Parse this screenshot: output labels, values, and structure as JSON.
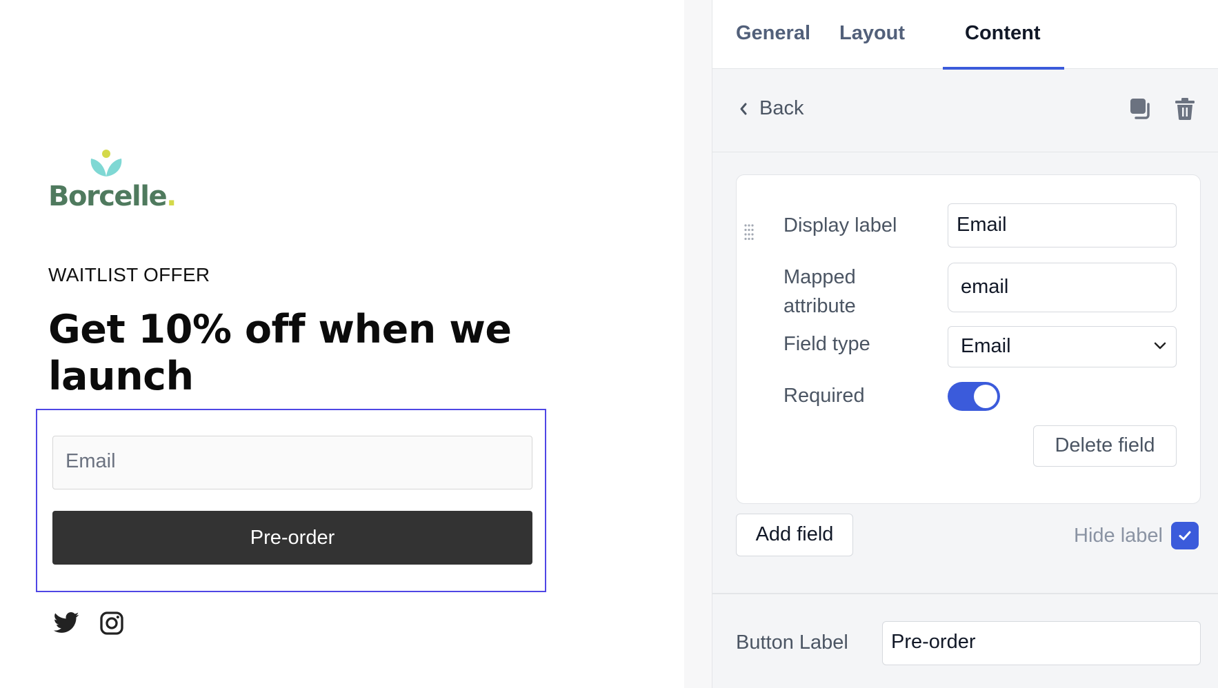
{
  "preview": {
    "brand": {
      "name": "Borcelle",
      "dot": "."
    },
    "eyebrow": "WAITLIST OFFER",
    "headline": "Get 10% off when we launch",
    "email_placeholder": "Email",
    "cta_label": "Pre-order",
    "social": [
      "twitter-icon",
      "instagram-icon"
    ]
  },
  "tabs": [
    {
      "label": "General",
      "active": false
    },
    {
      "label": "Layout",
      "active": false
    },
    {
      "label": "Content",
      "active": true
    }
  ],
  "toolbar": {
    "back_label": "Back",
    "icons": [
      "back-chevron-icon",
      "duplicate-icon",
      "trash-icon"
    ]
  },
  "field": {
    "display_label": {
      "label": "Display label",
      "value": "Email"
    },
    "mapped_attribute": {
      "label_line1": "Mapped",
      "label_line2": "attribute",
      "value": "email"
    },
    "field_type": {
      "label": "Field type",
      "value": "Email"
    },
    "required": {
      "label": "Required",
      "on": true
    },
    "delete_label": "Delete field"
  },
  "add_field_label": "Add field",
  "hide_label": {
    "label": "Hide label",
    "checked": true
  },
  "button_label": {
    "label": "Button Label",
    "value": "Pre-order"
  },
  "colors": {
    "accent": "#3b5bdb",
    "selection_outline": "#4f46e5",
    "cta_background": "#333333",
    "brand_green": "#4f7a5e",
    "brand_teal": "#7fd8d4",
    "brand_yellow": "#d4d94a"
  }
}
